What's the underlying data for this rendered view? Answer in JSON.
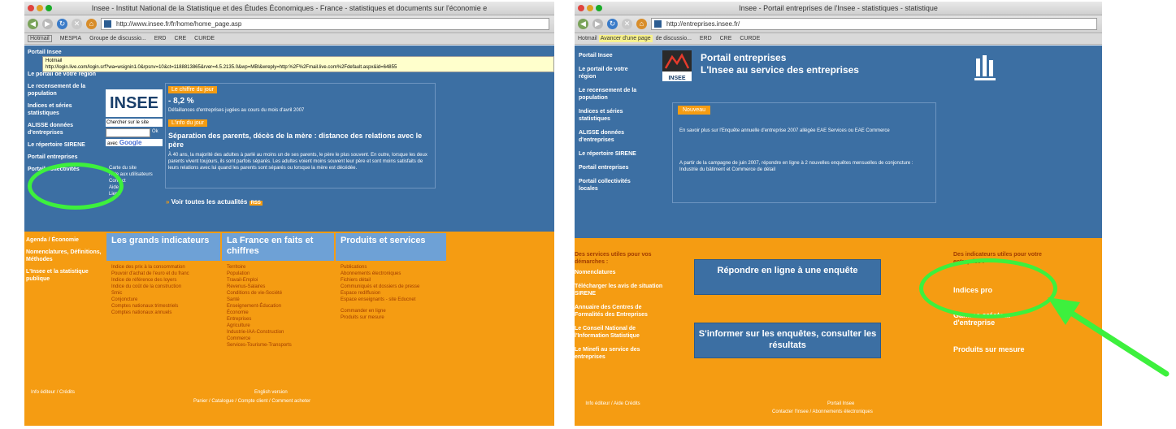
{
  "left": {
    "window_title": "Insee - Institut National de la Statistique et des Études Économiques - France - statistiques et documents sur l'économie e",
    "url": "http://www.insee.fr/fr/home/home_page.asp",
    "bookmarks": [
      "Hotmail",
      "MESPIA",
      "Groupe de discussio...",
      "ERD",
      "CRE",
      "CURDE"
    ],
    "tooltip_title": "Hotmail",
    "tooltip_url": "http://login.live.com/login.srf?wa=wsignin1.0&rpsnv=10&ct=1188813865&rver=4.5.2135.0&wp=MBI&wreply=http:%2F%2Fmail.live.com%2Fdefault.aspx&id=64855",
    "nav": [
      "Portail Insee",
      "Le portail de votre région",
      "Le recensement de la population",
      "Indices et séries statistiques",
      "ALISSE données d'entreprises",
      "Le répertoire SIRENE",
      "Portail entreprises",
      "Portail collectivités"
    ],
    "logo_text": "INSEE",
    "search_label": "Chercher sur le site",
    "search_button": "Ok",
    "google_label": "avec",
    "google_text": "Google",
    "small_links": [
      "Carte du site",
      "Aide aux utilisateurs",
      "Contact",
      "Aide",
      "Liens"
    ],
    "chiffre_tag": "Le chiffre du jour",
    "chiffre_value": "- 8,2 %",
    "chiffre_desc": "Défaillances d'entreprises jugées au cours du mois d'avril 2007",
    "info_tag": "L'info du jour",
    "info_title": "Séparation des parents, décès de la mère : distance des relations avec le père",
    "info_body": "À 40 ans, la majorité des adultes à parlé au moins un de ses parents, le père le plus souvent. En outre, lorsque les deux parents vivent toujours, ils sont parfois séparés. Les adultes voient moins souvent leur père et sont moins satisfaits de leurs relations avec lui quand les parents sont séparés ou lorsque la mère est décédée.",
    "actualites": "Voir toutes les actualités",
    "rss": "RSS",
    "orange_left_links": [
      "Agenda / Économie",
      "Nomenclatures, Définitions, Méthodes",
      "L'Insee et la statistique publique"
    ],
    "columns": [
      {
        "title": "Les grands indicateurs",
        "items": [
          "Indice des prix à la consommation",
          "Pouvoir d'achat de l'euro et du franc",
          "Indice de référence des loyers",
          "Indice du coût de la construction",
          "Smic",
          "Conjoncture",
          "Comptes nationaux trimestriels",
          "Comptes nationaux annuels"
        ]
      },
      {
        "title": "La France en faits et chiffres",
        "items": [
          "Territoire",
          "Population",
          "Travail-Emploi",
          "Revenus-Salaires",
          "Conditions de vie-Société",
          "Santé",
          "Enseignement-Éducation",
          "Économie",
          "Entreprises",
          "Agriculture",
          "Industrie-IAA-Construction",
          "Commerce",
          "Services-Tourisme-Transports"
        ]
      },
      {
        "title": "Produits et services",
        "items": [
          "Publications",
          "Abonnements électroniques",
          "Fichiers détail",
          "Communiqués et dossiers de presse",
          "Espace rediffusion",
          "Espace enseignants - site Educnet",
          "Commander en ligne",
          "Produits sur mesure"
        ]
      }
    ],
    "footer_left": "Info éditeur / Crédits",
    "footer_mid1": "English version",
    "footer_mid2": "Panier / Catalogue / Compte client / Comment acheter"
  },
  "right": {
    "window_title": "Insee - Portail entreprises de l'Insee - statistiques - statistique",
    "url": "http://entreprises.insee.fr/",
    "bookmarks_hot": "Avancer d'une page",
    "bookmarks": [
      "Hotmail",
      "de discussio...",
      "ERD",
      "CRE",
      "CURDE"
    ],
    "nav": [
      "Portail Insee",
      "Le portail de votre région",
      "Le recensement de la population",
      "Indices et séries statistiques",
      "ALISSE données d'entreprises",
      "Le répertoire SIRENE",
      "Portail entreprises",
      "Portail collectivités locales"
    ],
    "portal_title": "Portail entreprises",
    "portal_subtitle": "L'Insee au service des entreprises",
    "logo_text": "INSEE",
    "nouveau": "Nouveau",
    "news1": "En savoir plus sur l'Enquête annuelle d'entreprise 2007 allégée EAE Services ou EAE Commerce",
    "news2": "A partir de la campagne de juin 2007, répondre en ligne à 2 nouvelles enquêtes mensuelles de conjoncture : Industrie du bâtiment et Commerce de détail",
    "services_head": "Des services utiles pour vos démarches :",
    "services": [
      "Nomenclatures",
      "Télécharger les avis de situation SIRENE",
      "Annuaire des Centres de Formalités des Entreprises",
      "Le Conseil National de l'Information Statistique",
      "Le Minefi au service des entreprises"
    ],
    "btn1": "Répondre en ligne à une enquête",
    "btn2": "S'informer sur les enquêtes, consulter les résultats",
    "indicators_head": "Des indicateurs utiles pour votre entreprise :",
    "indicators": [
      "Indices pro",
      "Gamme créateur d'entreprise",
      "Produits sur mesure"
    ],
    "footer_left": "Info éditeur / Aide Crédits",
    "footer_mid1": "Portail Insee",
    "footer_mid2": "Contacter l'Insee / Abonnements électroniques"
  },
  "colors": {
    "blue": "#3c6fa3",
    "orange": "#f59c12",
    "highlight_green": "#3df03d"
  }
}
